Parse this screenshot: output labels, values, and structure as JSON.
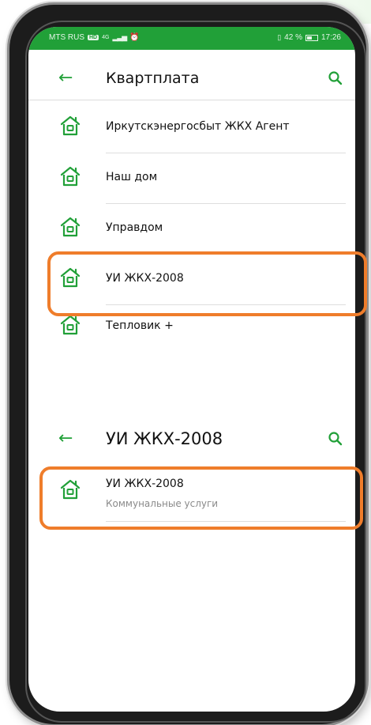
{
  "status_bar": {
    "carrier": "MTS RUS",
    "hd_badge": "HD",
    "network": "4G",
    "battery_percent": "42 %",
    "battery_level": 0.42,
    "time": "17:26"
  },
  "screen1": {
    "title": "Квартплата",
    "items": [
      {
        "label": "Иркутскэнергосбыт ЖКХ Агент"
      },
      {
        "label": "Наш дом"
      },
      {
        "label": "Управдом"
      },
      {
        "label": "УИ ЖКХ-2008"
      },
      {
        "label": "Тепловик +"
      }
    ]
  },
  "screen2": {
    "title": "УИ ЖКХ-2008",
    "item": {
      "label": "УИ ЖКХ-2008",
      "sublabel": "Коммунальные услуги"
    }
  },
  "colors": {
    "accent": "#21a038",
    "highlight": "#ef7d2b"
  },
  "icons": {
    "back": "arrow-left-icon",
    "search": "search-icon",
    "item": "house-icon"
  }
}
